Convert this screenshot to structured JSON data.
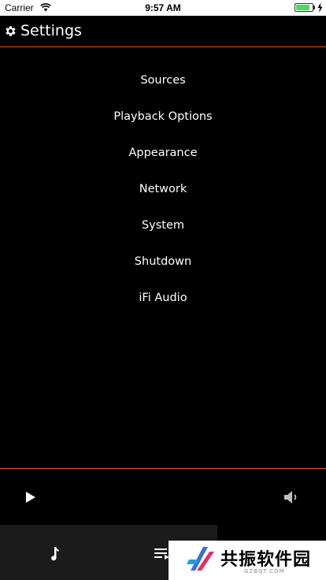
{
  "status_bar": {
    "carrier": "Carrier",
    "time": "9:57 AM",
    "battery_level": 0.85,
    "icons": [
      "wifi-icon",
      "battery-icon",
      "charging-bolt-icon"
    ]
  },
  "header": {
    "icon": "gear-icon",
    "title": "Settings"
  },
  "menu": {
    "items": [
      {
        "label": "Sources"
      },
      {
        "label": "Playback Options"
      },
      {
        "label": "Appearance"
      },
      {
        "label": "Network"
      },
      {
        "label": "System"
      },
      {
        "label": "Shutdown"
      },
      {
        "label": "iFi Audio"
      }
    ]
  },
  "player": {
    "play_icon": "play-icon",
    "volume_icon": "volume-icon"
  },
  "tabbar": {
    "tabs": [
      {
        "icon": "music-note-icon"
      },
      {
        "icon": "queue-list-icon"
      }
    ]
  },
  "watermark": {
    "title": "共振软件园",
    "subtitle": "GZBQT.COM"
  },
  "colors": {
    "accent": "#e05a1e",
    "background": "#000000",
    "text": "#ffffff",
    "tabbar": "#1b1b1b"
  }
}
